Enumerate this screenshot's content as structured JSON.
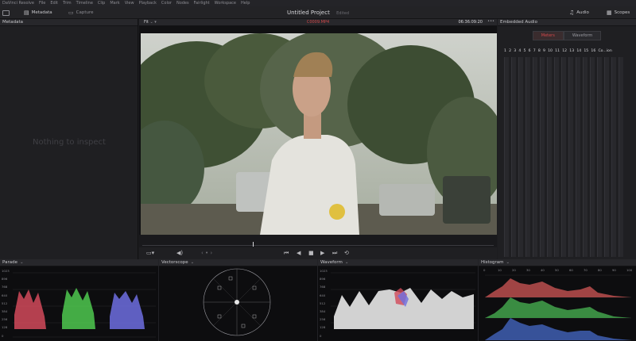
{
  "menubar": {
    "items": [
      "DaVinci Resolve",
      "File",
      "Edit",
      "Trim",
      "Timeline",
      "Clip",
      "Mark",
      "View",
      "Playback",
      "Color",
      "Nodes",
      "Fairlight",
      "Workspace",
      "Help"
    ]
  },
  "toolbar": {
    "metadata_label": "Metadata",
    "capture_label": "Capture",
    "project_title": "Untitled Project",
    "project_status": "Edited",
    "audio_label": "Audio",
    "scopes_label": "Scopes"
  },
  "metadata_panel": {
    "title": "Metadata",
    "empty_text": "Nothing to inspect"
  },
  "viewer": {
    "fit_label": "Fit",
    "clip_name": "C0009.MP4",
    "timecode": "06:36:09:20"
  },
  "audio_panel": {
    "title": "Embedded Audio",
    "tabs": [
      "Meters",
      "Waveform"
    ],
    "active_tab": "Meters",
    "channel_numbers": [
      "1",
      "2",
      "3",
      "4",
      "5",
      "6",
      "7",
      "8",
      "9",
      "10",
      "11",
      "12",
      "13",
      "14",
      "15",
      "16",
      "Co...ion"
    ]
  },
  "scopes": {
    "parade": {
      "title": "Parade",
      "scale": [
        "1023",
        "896",
        "768",
        "640",
        "512",
        "384",
        "256",
        "128",
        "0"
      ]
    },
    "vectorscope": {
      "title": "Vectorscope"
    },
    "waveform": {
      "title": "Waveform",
      "scale": [
        "1023",
        "896",
        "768",
        "640",
        "512",
        "384",
        "256",
        "128",
        "0"
      ]
    },
    "histogram": {
      "title": "Histogram",
      "scale": [
        "0",
        "10",
        "20",
        "30",
        "40",
        "50",
        "60",
        "70",
        "80",
        "90",
        "100"
      ]
    }
  },
  "colors": {
    "accent_red": "#d0484a",
    "panel_bg": "#1f1f22",
    "scope_bg": "#0d0d0f"
  }
}
